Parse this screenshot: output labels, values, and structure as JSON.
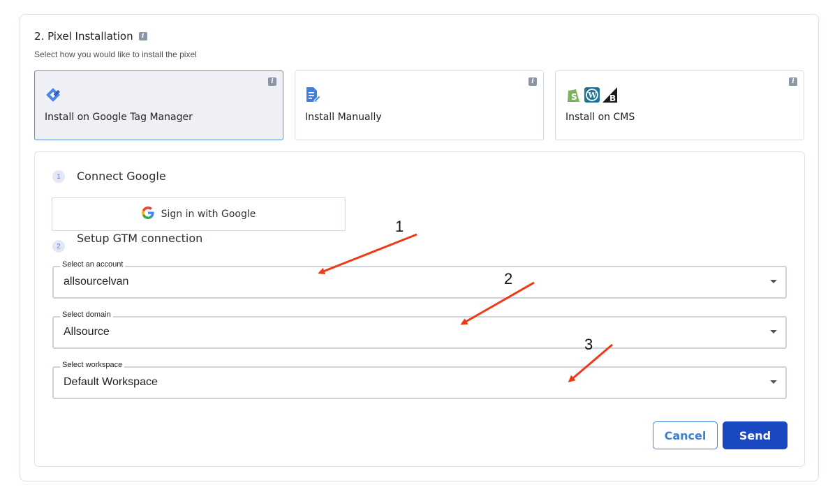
{
  "section": {
    "title": "2. Pixel Installation",
    "subtitle": "Select how you would like to install the pixel"
  },
  "options": [
    {
      "label": "Install on Google Tag Manager",
      "icon": "gtm-icon",
      "selected": true
    },
    {
      "label": "Install Manually",
      "icon": "document-edit-icon",
      "selected": false
    },
    {
      "label": "Install on CMS",
      "icon": "cms-logos-icon",
      "selected": false
    }
  ],
  "steps": [
    {
      "number": "1",
      "title": "Connect Google"
    },
    {
      "number": "2",
      "title": "Setup GTM connection"
    }
  ],
  "google_button": {
    "label": "Sign in with Google"
  },
  "fields": [
    {
      "legend": "Select an account",
      "value": "allsourcelvan"
    },
    {
      "legend": "Select domain",
      "value": "Allsource"
    },
    {
      "legend": "Select workspace",
      "value": "Default Workspace"
    }
  ],
  "buttons": {
    "cancel": "Cancel",
    "send": "Send"
  },
  "annotations": [
    "1",
    "2",
    "3"
  ],
  "colors": {
    "accent": "#1a47c2",
    "arrow": "#f03a17",
    "link": "#3b7fd9"
  }
}
